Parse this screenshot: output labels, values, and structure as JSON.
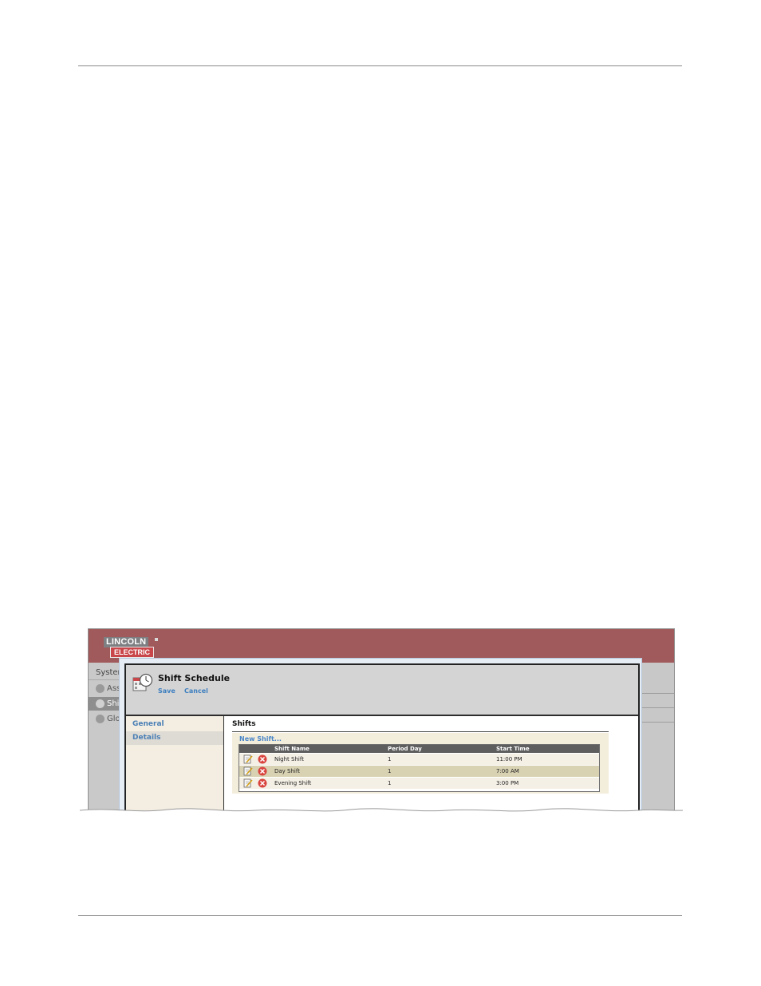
{
  "app": {
    "brand": {
      "line1": "LINCOLN",
      "line2": "ELECTRIC"
    },
    "bg_nav": {
      "items": [
        {
          "label": "System",
          "icon": "none"
        },
        {
          "label": "Ass",
          "icon": "link-icon"
        },
        {
          "label": "Shi",
          "icon": "clock-icon",
          "selected": true
        },
        {
          "label": "Glo",
          "icon": "globe-icon"
        }
      ]
    }
  },
  "dialog": {
    "title": "Shift Schedule",
    "icon": "calendar-clock-icon",
    "actions": {
      "save": "Save",
      "cancel": "Cancel"
    },
    "nav": [
      {
        "label": "General"
      },
      {
        "label": "Details",
        "selected": true
      }
    ],
    "section_title": "Shifts",
    "new_shift": "New Shift...",
    "table": {
      "columns": [
        "Shift Name",
        "Period Day",
        "Start Time"
      ],
      "rows": [
        {
          "name": "Night Shift",
          "day": "1",
          "time": "11:00 PM"
        },
        {
          "name": "Day Shift",
          "day": "1",
          "time": "7:00 AM",
          "highlighted": true
        },
        {
          "name": "Evening Shift",
          "day": "1",
          "time": "3:00 PM"
        }
      ]
    }
  },
  "colors": {
    "brand_bar": "#a15a5c",
    "link_blue": "#4a86c7",
    "header_gray": "#5e5e5e",
    "highlight_row": "#d8d2b2"
  }
}
